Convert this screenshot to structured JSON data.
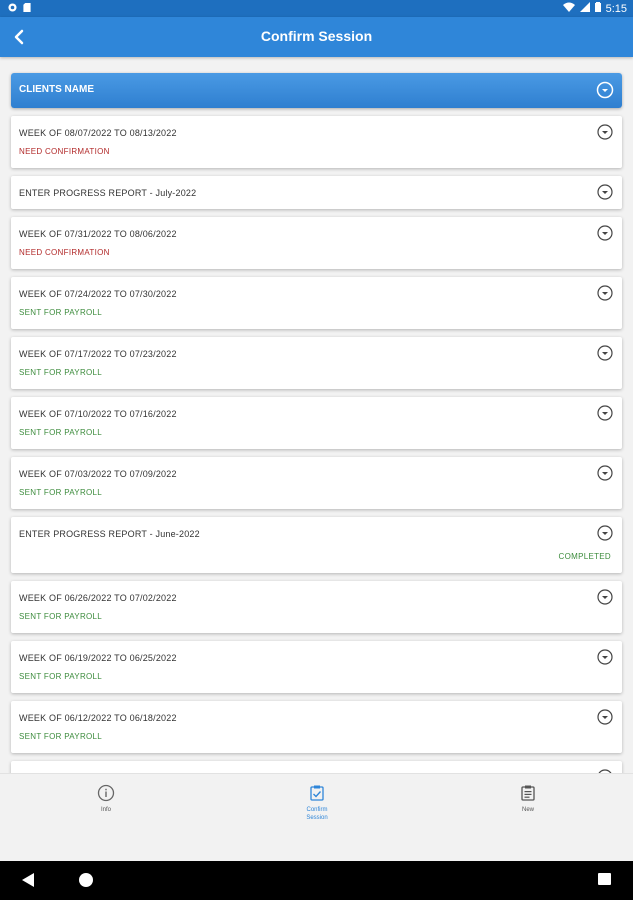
{
  "status_bar": {
    "time": "5:15"
  },
  "header": {
    "title": "Confirm Session"
  },
  "client": {
    "label": "CLIENTS NAME"
  },
  "colors": {
    "need": "#b22a2a",
    "sent": "#3d8c3d",
    "completed": "#3d8c3d",
    "accent": "#2f86d9"
  },
  "sessions": [
    {
      "title": "WEEK OF 08/07/2022 TO 08/13/2022",
      "status": "NEED CONFIRMATION"
    },
    {
      "title": "ENTER PROGRESS REPORT - July-2022",
      "status": ""
    },
    {
      "title": "WEEK OF 07/31/2022 TO 08/06/2022",
      "status": "NEED CONFIRMATION"
    },
    {
      "title": "WEEK OF 07/24/2022 TO 07/30/2022",
      "status": "SENT FOR PAYROLL"
    },
    {
      "title": "WEEK OF 07/17/2022 TO 07/23/2022",
      "status": "SENT FOR PAYROLL"
    },
    {
      "title": "WEEK OF 07/10/2022 TO 07/16/2022",
      "status": "SENT FOR PAYROLL"
    },
    {
      "title": "WEEK OF 07/03/2022 TO 07/09/2022",
      "status": "SENT FOR PAYROLL"
    },
    {
      "title": "ENTER PROGRESS REPORT - June-2022",
      "status": "COMPLETED"
    },
    {
      "title": "WEEK OF 06/26/2022 TO 07/02/2022",
      "status": "SENT FOR PAYROLL"
    },
    {
      "title": "WEEK OF 06/19/2022 TO 06/25/2022",
      "status": "SENT FOR PAYROLL"
    },
    {
      "title": "WEEK OF 06/12/2022 TO 06/18/2022",
      "status": "SENT FOR PAYROLL"
    }
  ],
  "bottom_nav": {
    "items": [
      {
        "label": "Info",
        "icon": "info-icon"
      },
      {
        "label": "Confirm Session",
        "icon": "confirm-session-icon",
        "active": true
      },
      {
        "label": "New",
        "icon": "clipboard-icon"
      }
    ]
  }
}
